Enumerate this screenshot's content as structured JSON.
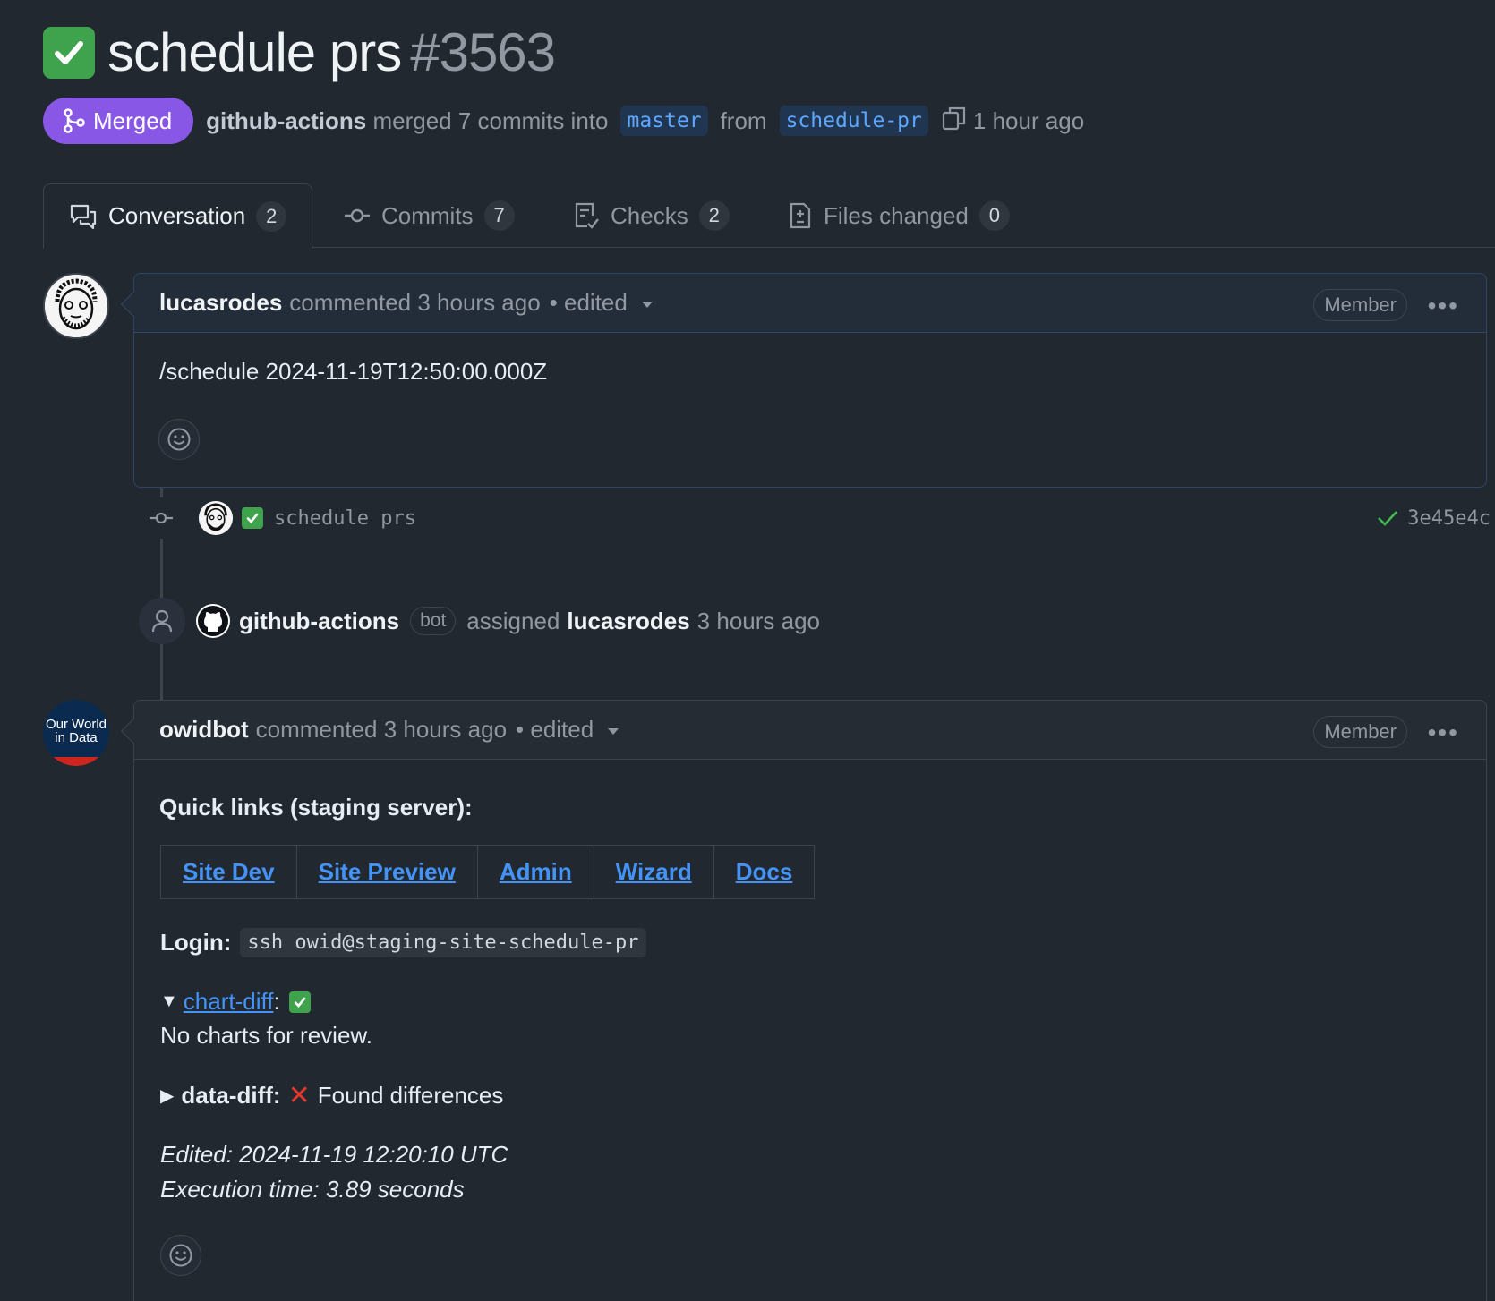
{
  "pr": {
    "title": "schedule prs",
    "number": "#3563",
    "state": "Merged",
    "author": "github-actions",
    "merge_text": "merged 7 commits into",
    "base_branch": "master",
    "from_text": "from",
    "head_branch": "schedule-pr",
    "time": "1 hour ago"
  },
  "tabs": [
    {
      "label": "Conversation",
      "count": "2"
    },
    {
      "label": "Commits",
      "count": "7"
    },
    {
      "label": "Checks",
      "count": "2"
    },
    {
      "label": "Files changed",
      "count": "0"
    }
  ],
  "comment1": {
    "author": "lucasrodes",
    "meta": "commented 3 hours ago",
    "edited": "• edited",
    "badge": "Member",
    "body": "/schedule 2024-11-19T12:50:00.000Z"
  },
  "commit": {
    "message": "schedule prs",
    "sha": "3e45e4c"
  },
  "event": {
    "actor": "github-actions",
    "badge": "bot",
    "action": "assigned",
    "target": "lucasrodes",
    "time": "3 hours ago"
  },
  "comment2": {
    "author": "owidbot",
    "meta": "commented 3 hours ago",
    "edited": "• edited",
    "badge": "Member",
    "avatar_text": "Our World in Data",
    "heading": "Quick links (staging server):",
    "links": [
      "Site Dev",
      "Site Preview",
      "Admin",
      "Wizard",
      "Docs"
    ],
    "login_label": "Login:",
    "login_value": "ssh owid@staging-site-schedule-pr",
    "chart_diff_link": "chart-diff",
    "chart_diff_body": "No charts for review.",
    "data_diff_label": "data-diff:",
    "data_diff_value": "Found differences",
    "edited_line": "Edited: 2024-11-19 12:20:10 UTC",
    "exec_line": "Execution time: 3.89 seconds"
  },
  "colors": {
    "background": "#212830",
    "merged": "#8957e5",
    "link": "#4493f8",
    "success": "#3fa34d"
  }
}
